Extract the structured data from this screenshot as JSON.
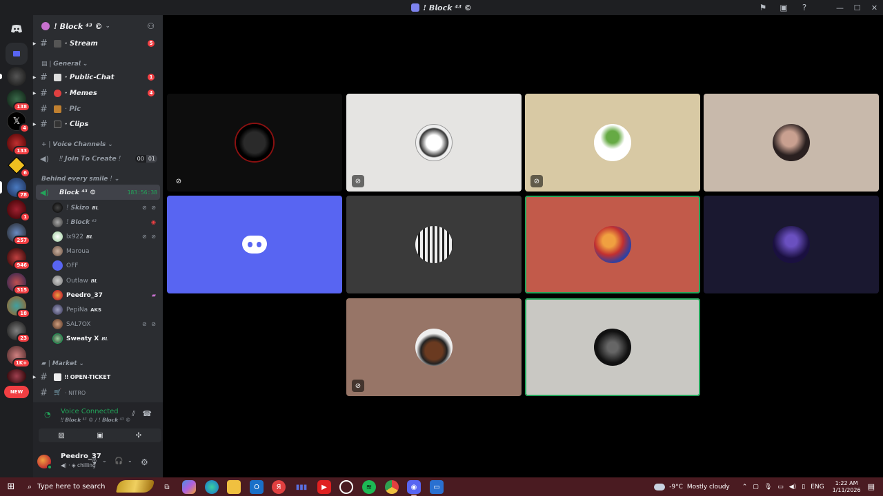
{
  "window": {
    "title": "! 𝘽𝙡𝙤𝙘𝙠 ⁴³ ©",
    "controls": [
      "minimize",
      "maximize",
      "close"
    ]
  },
  "server": {
    "name": "! 𝘽𝙡𝙤𝙘𝙠 ⁴³ ©",
    "rail_badges": [
      "138",
      "4",
      "133",
      "6",
      "78",
      "1",
      "257",
      "946",
      "315",
      "18",
      "23",
      "1K+"
    ],
    "new_label": "NEW"
  },
  "channels": {
    "stream": {
      "label": "· 𝙎𝙩𝙧𝙚𝙖𝙢",
      "mentions": "5"
    },
    "category_general": "| 𝙂𝙚𝙣𝙚𝙧𝙖𝙡",
    "public_chat": {
      "label": "· 𝙋𝙪𝙗𝙡𝙞𝙘-𝘾𝙝𝙖𝙩",
      "mentions": "1"
    },
    "memes": {
      "label": "· 𝙈𝙚𝙢𝙚𝙨",
      "mentions": "4"
    },
    "pic": {
      "label": "· 𝙋𝙞𝙘"
    },
    "clips": {
      "label": "· 𝘾𝙡𝙞𝙥𝙨"
    },
    "category_voice": "| 𝙑𝙤𝙞𝙘𝙚 𝘾𝙝𝙖𝙣𝙣𝙚𝙡𝙨",
    "join_to_create": {
      "label": "‼ 𝙅𝙤𝙞𝙣 𝙏𝙤 𝘾𝙧𝙚𝙖𝙩𝙚 !",
      "count_left": "00",
      "count_right": "01"
    },
    "category_behind": "𝘽𝙚𝙝𝙞𝙣𝙙 𝙚𝙫𝙚𝙧𝙮 𝙨𝙢𝙞𝙡𝙚 !",
    "block_vc": {
      "label": "𝘽𝙡𝙤𝙘𝙠 ⁴³ ©",
      "timer": "183:56:38"
    },
    "category_market": "| 𝙈𝙖𝙧𝙠𝙚𝙩",
    "open_ticket": {
      "label": "‼ OPEN-TICKET"
    },
    "nitro": {
      "label": "· NITRO"
    }
  },
  "voice_members": [
    {
      "name": "! 𝙎𝙠𝙞𝙯𝙤",
      "tag": "𝘽𝙇",
      "icons": "⊘ ⊘"
    },
    {
      "name": "! 𝘽𝙡𝙤𝙘𝙠 ⁴³",
      "tag": "",
      "icons": "◉"
    },
    {
      "name": "lx922",
      "tag": "𝘽𝙇",
      "icons": "⊘ ⊘"
    },
    {
      "name": "Maroua",
      "tag": "",
      "icons": ""
    },
    {
      "name": "OFF",
      "tag": "",
      "icons": ""
    },
    {
      "name": "Outlaw",
      "tag": "𝘽𝙇",
      "icons": ""
    },
    {
      "name": "Peedro_37",
      "tag": "",
      "icons": "▰"
    },
    {
      "name": "PepiNa",
      "tag": "AKS",
      "icons": ""
    },
    {
      "name": "SAL7OX",
      "tag": "",
      "icons": "⊘ ⊘"
    },
    {
      "name": "Sweaty X",
      "tag": "𝘽𝙇",
      "icons": ""
    }
  ],
  "voice_panel": {
    "status": "Voice Connected",
    "channel": "‼ 𝘽𝙡𝙤𝙘𝙠 ⁴³ © / ! 𝘽𝙡𝙤𝙘𝙠 ⁴³ ©"
  },
  "user_panel": {
    "username": "Peedro_37",
    "status": "chilling"
  },
  "taskbar": {
    "search_placeholder": "Type here to search",
    "temperature": "-9°C",
    "weather": "Mostly cloudy",
    "language": "ENG",
    "time": "1:22 AM",
    "date": "1/11/2026"
  },
  "colors": {
    "accent_green": "#23a55a",
    "blurple": "#5865f2",
    "mention_red": "#f23f43",
    "taskbar_bg": "#4a1b21"
  }
}
